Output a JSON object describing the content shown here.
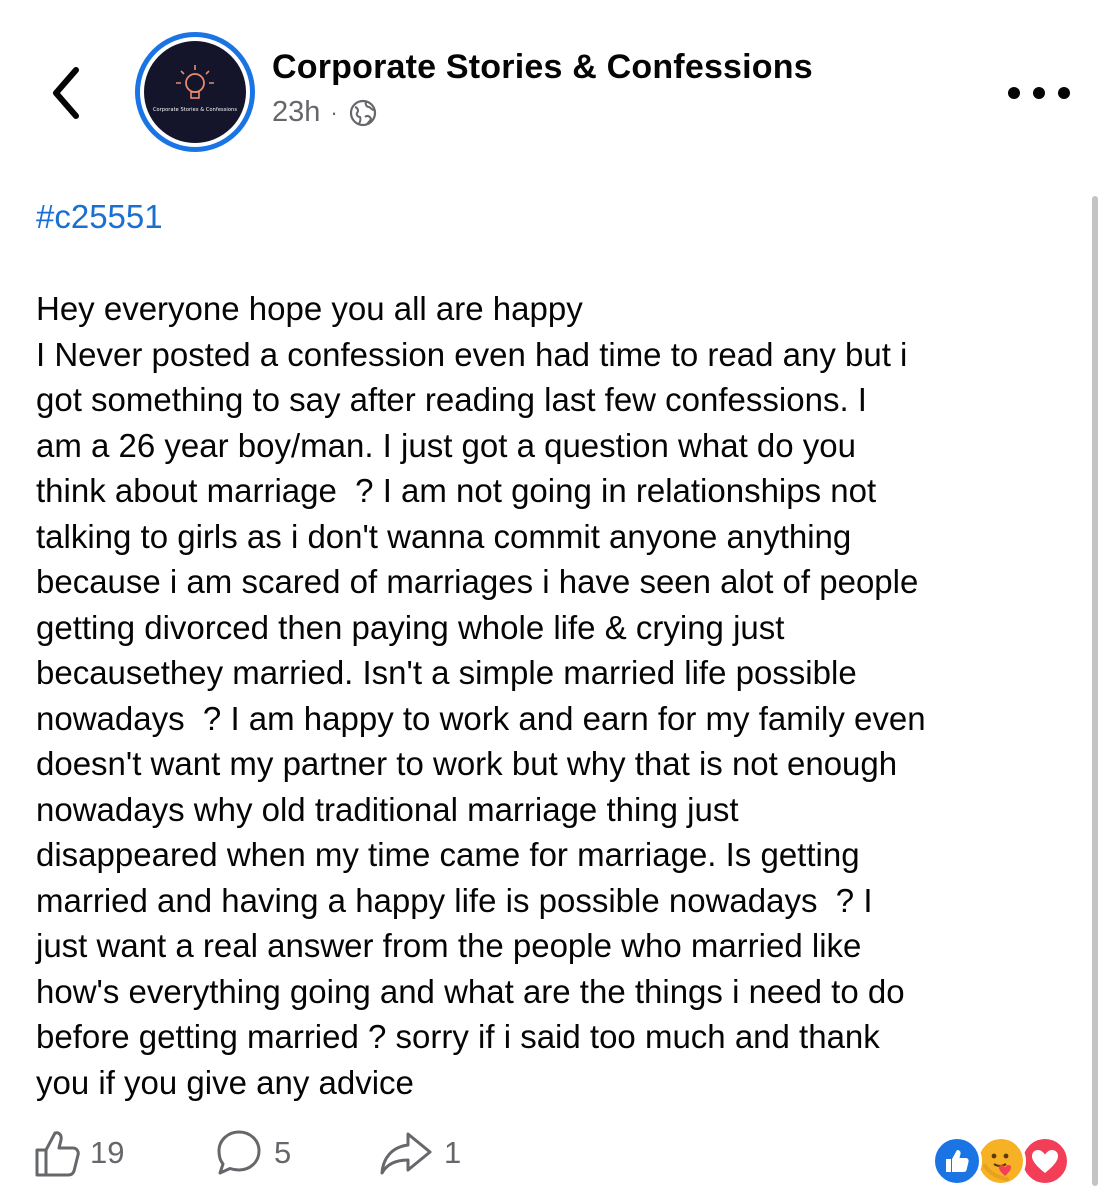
{
  "header": {
    "page_name": "Corporate Stories & Confessions",
    "time": "23h",
    "separator": "·",
    "avatar_text": "Corporate Stories & Confessions"
  },
  "post": {
    "hashtag": "#c25551",
    "lines": [
      "Hey everyone hope you all are happy",
      "I Never posted a confession even had time to read any but i",
      "got something to say after reading last few confessions. I",
      "am a 26 year boy/man. I just got a question what do you",
      "think about marriage  ? I am not going in relationships not",
      "talking to girls as i don't wanna commit anyone anything",
      "because i am scared of marriages i have seen alot of people",
      "getting divorced then paying whole life & crying just",
      "becausethey married. Isn't a simple married life possible",
      "nowadays  ? I am happy to work and earn for my family even",
      "doesn't want my partner to work but why that is not enough",
      "nowadays why old traditional marriage thing just",
      "disappeared when my time came for marriage. Is getting",
      "married and having a happy life is possible nowadays  ? I",
      "just want a real answer from the people who married like",
      "how's everything going and what are the things i need to do",
      "before getting married ? sorry if i said too much and thank",
      "you if you give any advice"
    ]
  },
  "actions": {
    "likes": "19",
    "comments": "5",
    "shares": "1"
  },
  "colors": {
    "accent": "#1b74e4",
    "hashtag": "#1b6fd1",
    "secondary_text": "#65676b",
    "love": "#f33e58",
    "care": "#f7b125"
  },
  "icons": [
    "back-chevron-icon",
    "globe-icon",
    "more-dots-icon",
    "like-icon",
    "comment-icon",
    "share-icon",
    "like-reaction-icon",
    "care-reaction-icon",
    "love-reaction-icon"
  ]
}
